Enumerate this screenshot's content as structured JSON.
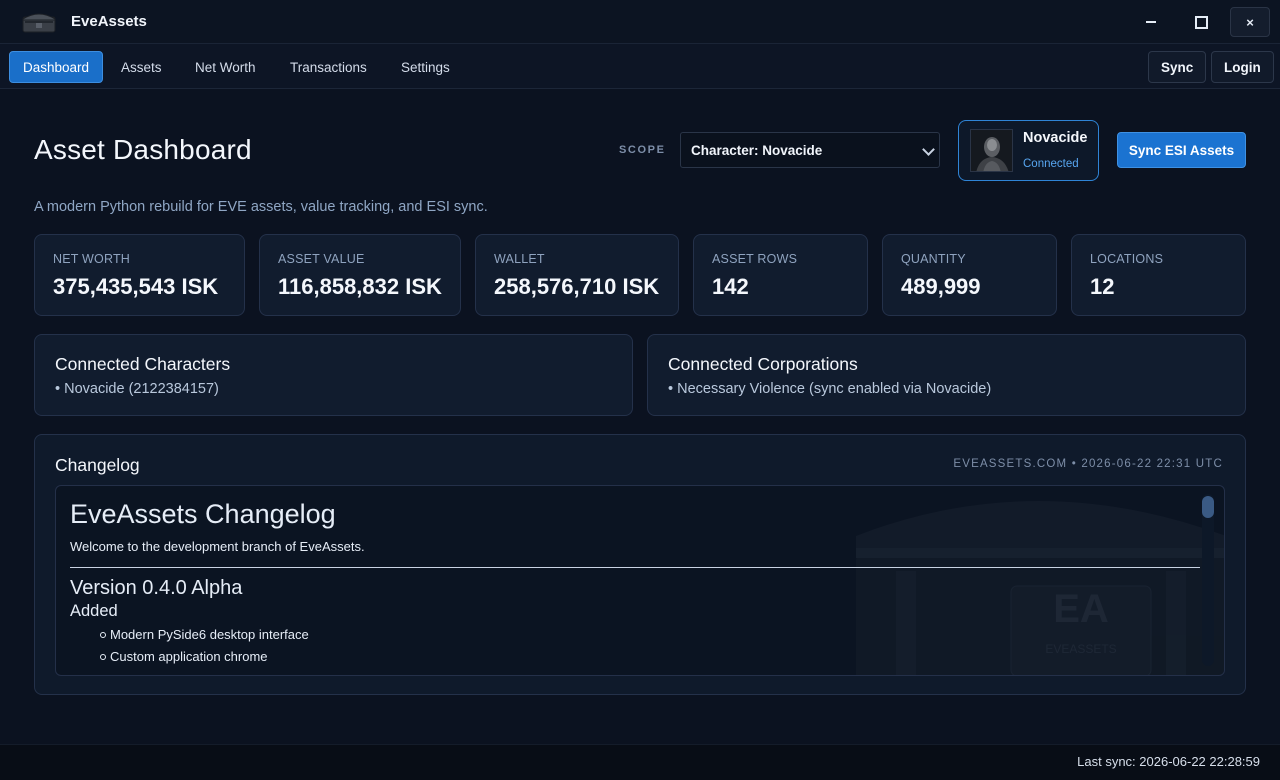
{
  "window": {
    "title": "EveAssets",
    "logo_icon": "treasure-chest-icon",
    "controls": {
      "minimize_icon": "minimize-icon",
      "maximize_icon": "maximize-icon",
      "close_label": "×"
    }
  },
  "nav": {
    "tabs": [
      {
        "label": "Dashboard",
        "active": true
      },
      {
        "label": "Assets",
        "active": false
      },
      {
        "label": "Net Worth",
        "active": false
      },
      {
        "label": "Transactions",
        "active": false
      },
      {
        "label": "Settings",
        "active": false
      }
    ],
    "sync_label": "Sync",
    "login_label": "Login"
  },
  "header": {
    "title": "Asset Dashboard",
    "subtitle": "A modern Python rebuild for EVE assets, value tracking, and ESI sync.",
    "scope_label": "SCOPE",
    "scope_value": "Character: Novacide",
    "character": {
      "name": "Novacide",
      "status": "Connected"
    },
    "sync_esi_label": "Sync ESI Assets"
  },
  "stats": [
    {
      "label": "NET WORTH",
      "value": "375,435,543 ISK"
    },
    {
      "label": "ASSET VALUE",
      "value": "116,858,832 ISK"
    },
    {
      "label": "WALLET",
      "value": "258,576,710 ISK"
    },
    {
      "label": "ASSET ROWS",
      "value": "142"
    },
    {
      "label": "QUANTITY",
      "value": "489,999"
    },
    {
      "label": "LOCATIONS",
      "value": "12"
    }
  ],
  "connected_characters": {
    "title": "Connected Characters",
    "items": [
      "• Novacide (2122384157)"
    ]
  },
  "connected_corporations": {
    "title": "Connected Corporations",
    "items": [
      "• Necessary Violence (sync enabled via Novacide)"
    ]
  },
  "changelog": {
    "title": "Changelog",
    "meta": "EVEASSETS.COM • 2026-06-22 22:31 UTC",
    "heading": "EveAssets Changelog",
    "welcome": "Welcome to the development branch of EveAssets.",
    "version": "Version 0.4.0 Alpha",
    "section": "Added",
    "items": [
      "Modern PySide6 desktop interface",
      "Custom application chrome"
    ],
    "watermark_text": "EA",
    "watermark_subtext": "EVEASSETS"
  },
  "status": {
    "last_sync": "Last sync: 2026-06-22 22:28:59"
  },
  "colors": {
    "accent": "#1b73d1",
    "background": "#0b1220",
    "card": "#111c2e",
    "connected": "#58a6f0"
  }
}
